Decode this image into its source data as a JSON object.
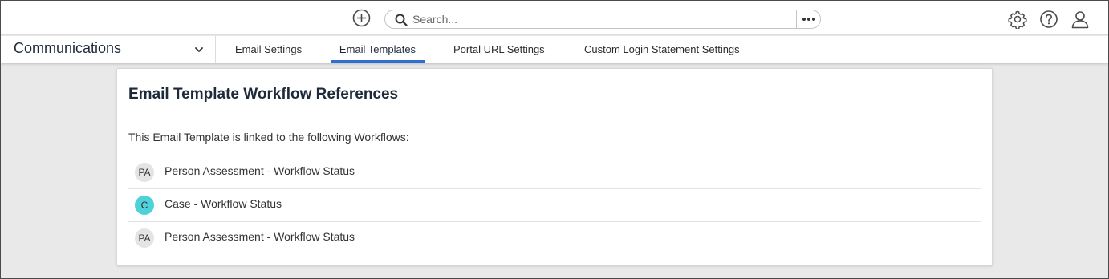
{
  "header": {
    "search": {
      "placeholder": "Search...",
      "value": ""
    },
    "icons": {
      "add": "plus-circle-icon",
      "search": "search-icon",
      "more": "ellipsis-icon",
      "settings": "gear-icon",
      "help": "help-icon",
      "profile": "user-icon"
    }
  },
  "nav": {
    "module": "Communications",
    "tabs": [
      {
        "label": "Email Settings",
        "active": false
      },
      {
        "label": "Email Templates",
        "active": true
      },
      {
        "label": "Portal URL Settings",
        "active": false
      },
      {
        "label": "Custom Login Statement Settings",
        "active": false
      }
    ]
  },
  "card": {
    "title": "Email Template Workflow References",
    "description": "This Email Template is linked to the following Workflows:",
    "workflows": [
      {
        "initials": "PA",
        "label": "Person Assessment - Workflow Status",
        "color": "#e4e4e4"
      },
      {
        "initials": "C",
        "label": "Case - Workflow Status",
        "color": "#4fd1d9"
      },
      {
        "initials": "PA",
        "label": "Person Assessment - Workflow Status",
        "color": "#e4e4e4"
      }
    ]
  },
  "colors": {
    "accent": "#2e6fcf",
    "background": "#e9e9e9"
  }
}
